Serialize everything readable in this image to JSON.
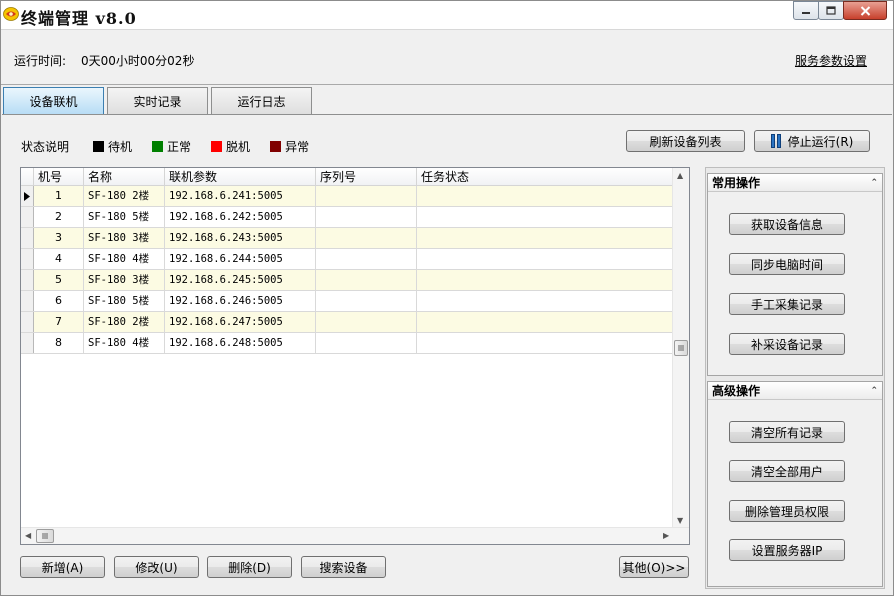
{
  "window": {
    "title": "终端管理 v8.0"
  },
  "info": {
    "runtime_label": "运行时间:",
    "runtime_value": "0天00小时00分02秒",
    "service_settings": "服务参数设置"
  },
  "tabs": [
    {
      "label": "设备联机",
      "active": true
    },
    {
      "label": "实时记录",
      "active": false
    },
    {
      "label": "运行日志",
      "active": false
    }
  ],
  "legend": {
    "title": "状态说明",
    "items": [
      {
        "label": "待机",
        "color": "#000000"
      },
      {
        "label": "正常",
        "color": "#008000"
      },
      {
        "label": "脱机",
        "color": "#ff0000"
      },
      {
        "label": "异常",
        "color": "#800000"
      }
    ]
  },
  "toolbar": {
    "refresh": "刷新设备列表",
    "stop": "停止运行(R)"
  },
  "grid": {
    "columns": [
      "机号",
      "名称",
      "联机参数",
      "序列号",
      "任务状态"
    ],
    "rows": [
      {
        "id": "1",
        "name": "SF-180 2楼",
        "param": "192.168.6.241:5005",
        "serial": "",
        "status": ""
      },
      {
        "id": "2",
        "name": "SF-180 5楼",
        "param": "192.168.6.242:5005",
        "serial": "",
        "status": ""
      },
      {
        "id": "3",
        "name": "SF-180 3楼",
        "param": "192.168.6.243:5005",
        "serial": "",
        "status": ""
      },
      {
        "id": "4",
        "name": "SF-180 4楼",
        "param": "192.168.6.244:5005",
        "serial": "",
        "status": ""
      },
      {
        "id": "5",
        "name": "SF-180 3楼",
        "param": "192.168.6.245:5005",
        "serial": "",
        "status": ""
      },
      {
        "id": "6",
        "name": "SF-180 5楼",
        "param": "192.168.6.246:5005",
        "serial": "",
        "status": ""
      },
      {
        "id": "7",
        "name": "SF-180 2楼",
        "param": "192.168.6.247:5005",
        "serial": "",
        "status": ""
      },
      {
        "id": "8",
        "name": "SF-180 4楼",
        "param": "192.168.6.248:5005",
        "serial": "",
        "status": ""
      }
    ]
  },
  "bottom_buttons": {
    "add": "新增(A)",
    "edit": "修改(U)",
    "delete": "删除(D)",
    "search": "搜索设备",
    "other": "其他(O)>>"
  },
  "common_ops": {
    "title": "常用操作",
    "buttons": [
      "获取设备信息",
      "同步电脑时间",
      "手工采集记录",
      "补采设备记录"
    ]
  },
  "advanced_ops": {
    "title": "高级操作",
    "buttons": [
      "清空所有记录",
      "清空全部用户",
      "删除管理员权限",
      "设置服务器IP"
    ]
  }
}
